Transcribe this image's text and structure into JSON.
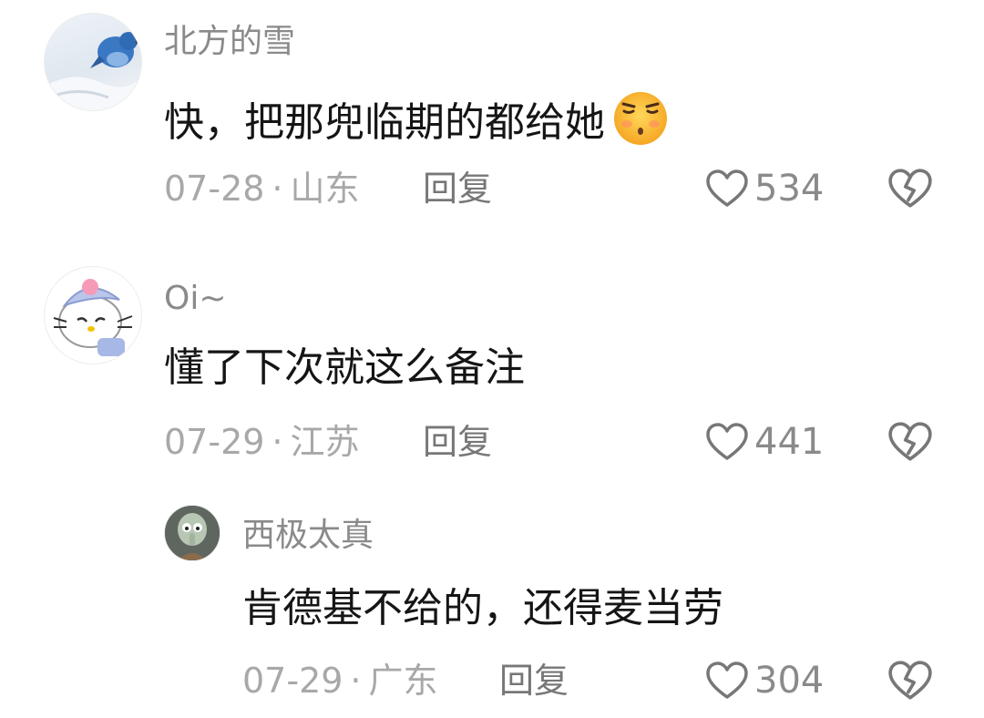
{
  "comments": [
    {
      "username": "北方的雪",
      "text": "快，把那兜临期的都给她",
      "emoji": "face-with-raised-eyebrow-emoji",
      "date": "07-28",
      "location": "山东",
      "separator": "·",
      "reply_label": "回复",
      "likes": "534",
      "avatar": "bluebird-in-snow-avatar"
    },
    {
      "username": "Oi~",
      "text": "懂了下次就这么备注",
      "date": "07-29",
      "location": "江苏",
      "separator": "·",
      "reply_label": "回复",
      "likes": "441",
      "avatar": "hello-kitty-avatar"
    },
    {
      "username": "西极太真",
      "text": "肯德基不给的，还得麦当劳",
      "date": "07-29",
      "location": "广东",
      "separator": "·",
      "reply_label": "回复",
      "likes": "304",
      "avatar": "squidward-avatar"
    }
  ],
  "colors": {
    "username": "#8a8a8a",
    "text": "#151515",
    "meta": "#a8a8a8",
    "icon": "#777777"
  }
}
